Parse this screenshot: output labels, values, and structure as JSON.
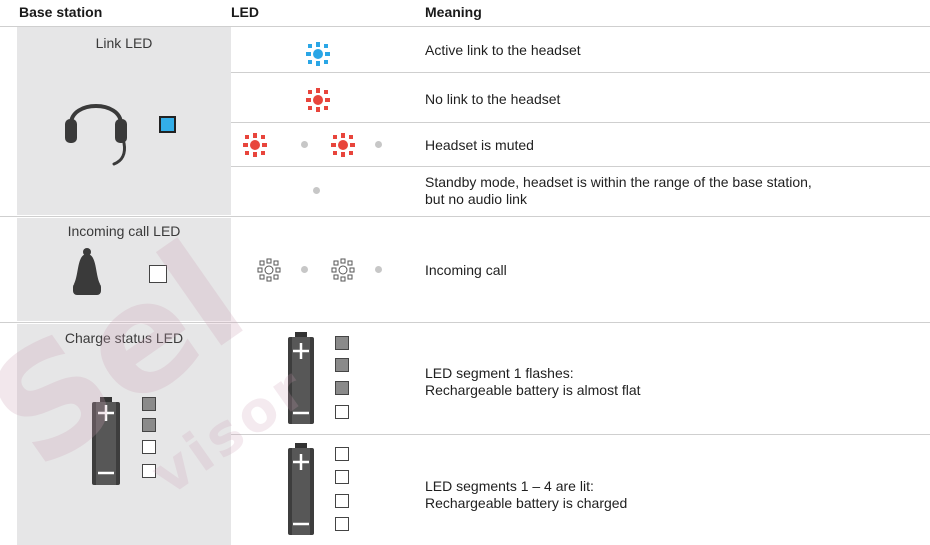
{
  "headers": {
    "base_station": "Base station",
    "led": "LED",
    "meaning": "Meaning"
  },
  "groups": [
    {
      "caption": "Link LED",
      "indicator_color": "#33aee8"
    },
    {
      "caption": "Incoming call LED"
    },
    {
      "caption": "Charge status LED"
    }
  ],
  "rows": [
    {
      "meaning": "Active link to the headset",
      "led_color": "#2aa6e6"
    },
    {
      "meaning": "No link to the headset",
      "led_color": "#e8453c"
    },
    {
      "meaning": "Headset is muted",
      "led_color": "#e8453c"
    },
    {
      "meaning_line1": "Standby mode, headset is within the range of the base station,",
      "meaning_line2": "but no audio link"
    },
    {
      "meaning": "Incoming call"
    },
    {
      "meaning_line1": "LED segment 1 flashes:",
      "meaning_line2": "Rechargeable battery is almost flat"
    },
    {
      "meaning_line1": "LED segments 1 – 4 are lit:",
      "meaning_line2": "Rechargeable battery is charged"
    }
  ],
  "watermark": {
    "big": "Sel",
    "small": "visor"
  }
}
